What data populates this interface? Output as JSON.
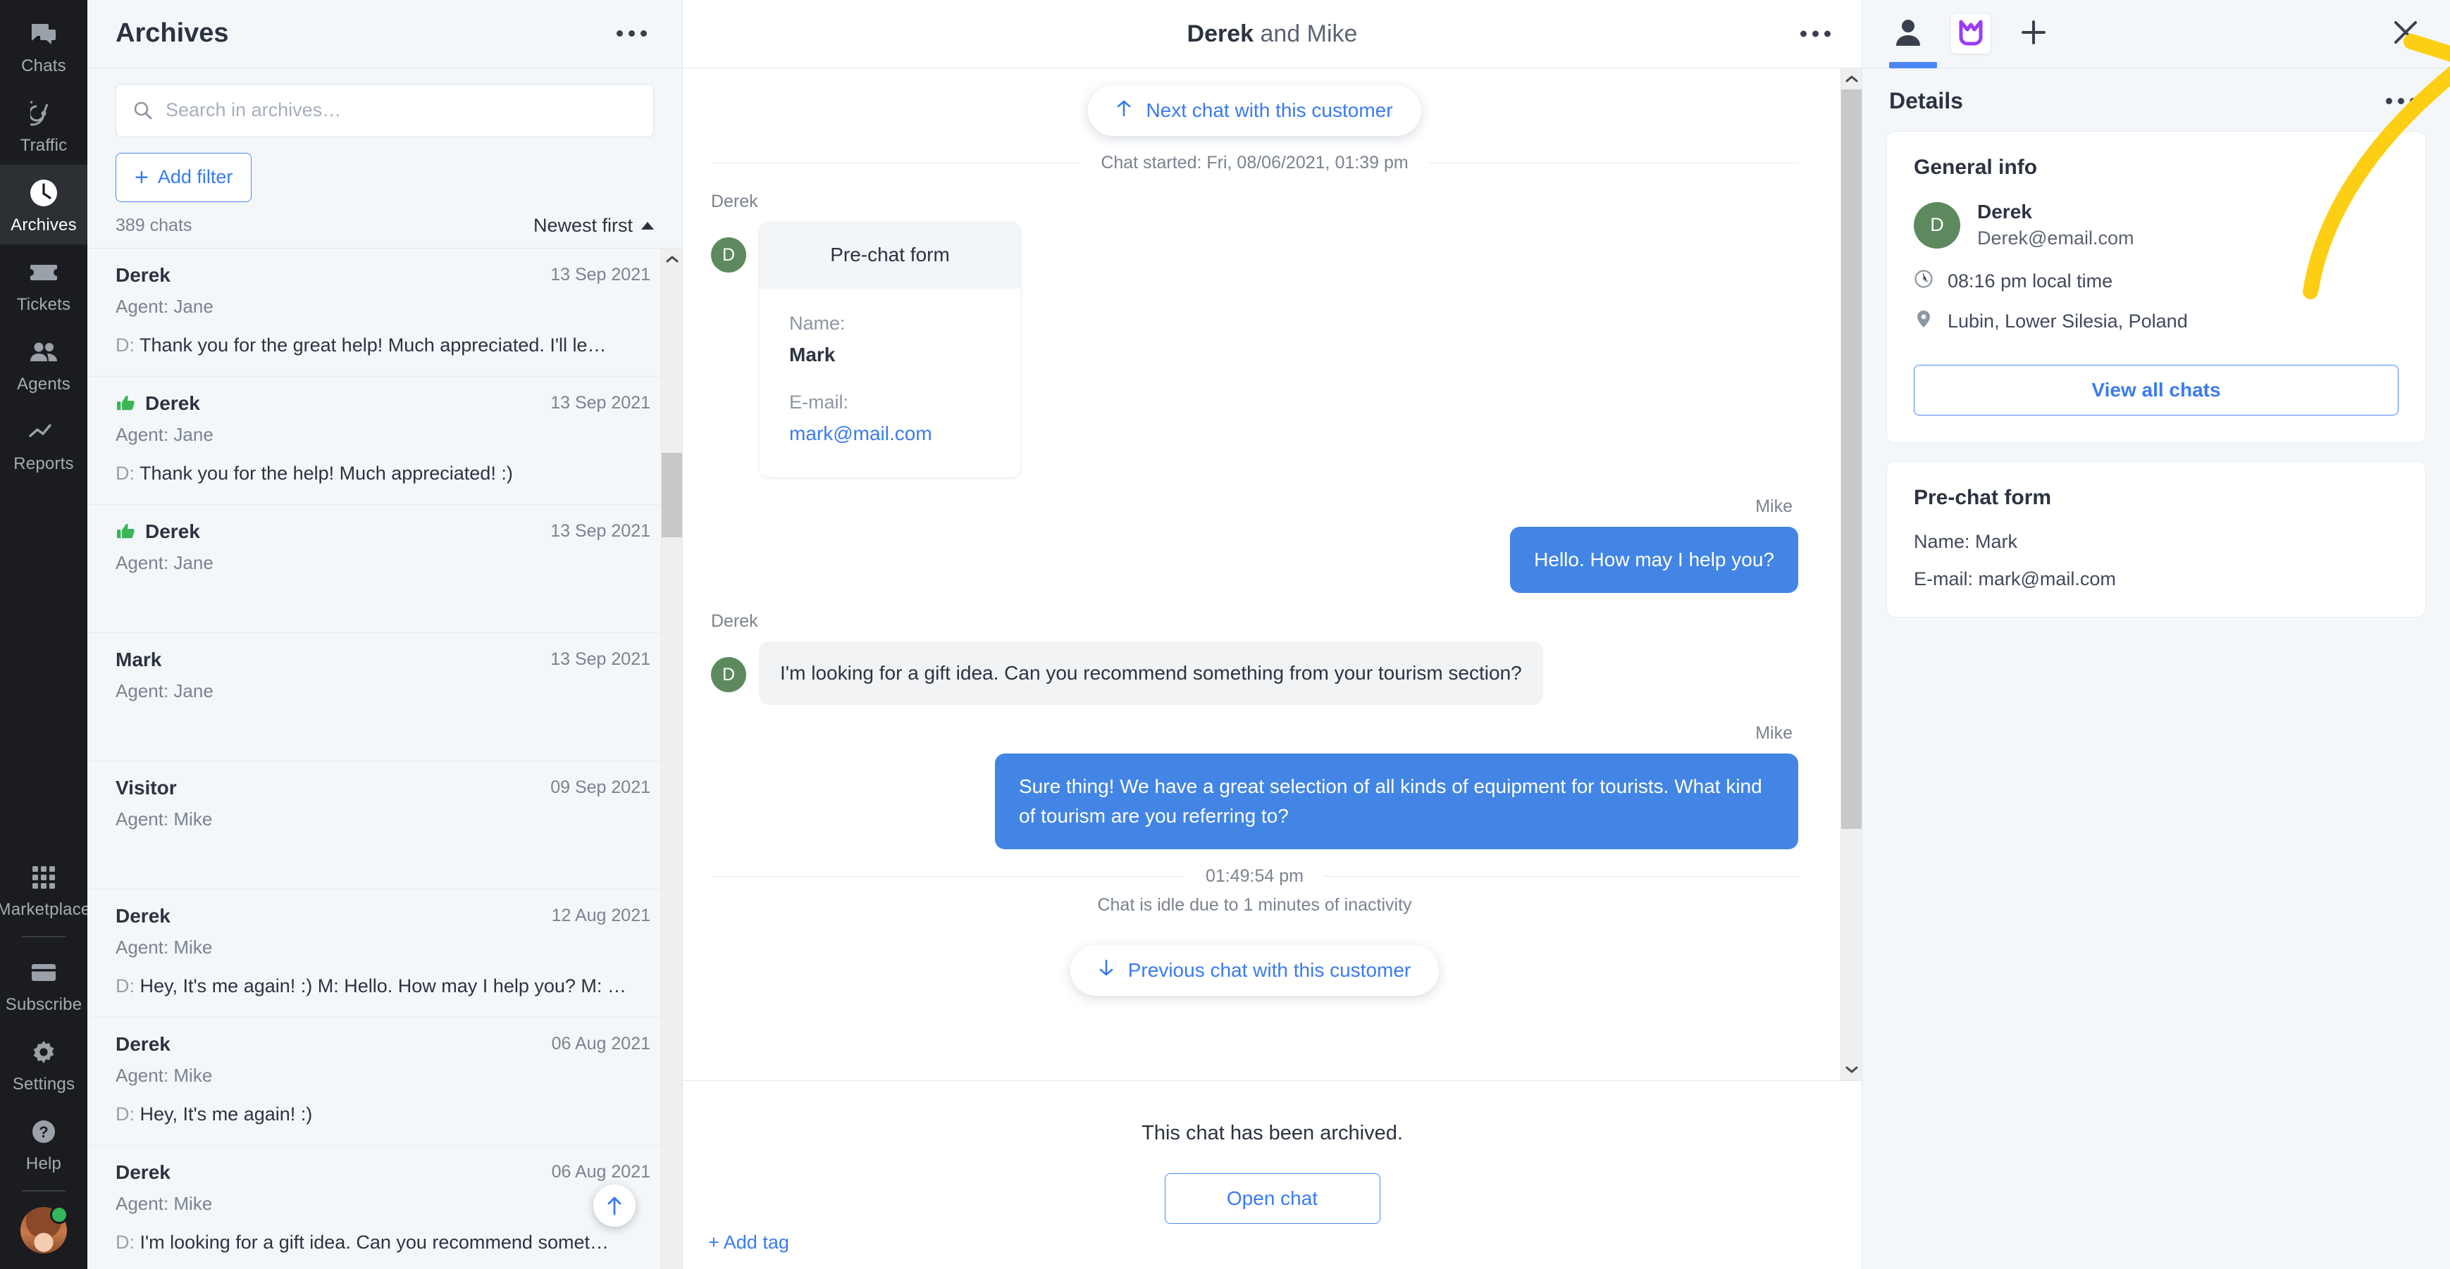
{
  "rail": {
    "items": [
      {
        "label": "Chats",
        "icon": "chats-icon",
        "active": false
      },
      {
        "label": "Traffic",
        "icon": "traffic-icon",
        "active": false
      },
      {
        "label": "Archives",
        "icon": "clock-icon",
        "active": true
      },
      {
        "label": "Tickets",
        "icon": "ticket-icon",
        "active": false
      },
      {
        "label": "Agents",
        "icon": "agents-icon",
        "active": false
      },
      {
        "label": "Reports",
        "icon": "reports-icon",
        "active": false
      }
    ],
    "bottom_items": [
      {
        "label": "Marketplace",
        "icon": "grid-icon"
      },
      {
        "label": "Subscribe",
        "icon": "card-icon"
      },
      {
        "label": "Settings",
        "icon": "gear-icon"
      },
      {
        "label": "Help",
        "icon": "help-icon"
      }
    ]
  },
  "archives": {
    "title": "Archives",
    "search_placeholder": "Search in archives…",
    "search_value": "",
    "add_filter_label": "Add filter",
    "count_label": "389 chats",
    "sort_label": "Newest first",
    "rows": [
      {
        "name": "Derek",
        "date": "13 Sep 2021",
        "agent": "Agent: Jane",
        "prefix": "D:",
        "snippet": "Thank you for the great help! Much appreciated. I'll le…",
        "rated": false
      },
      {
        "name": "Derek",
        "date": "13 Sep 2021",
        "agent": "Agent: Jane",
        "prefix": "D:",
        "snippet": "Thank you for the help! Much appreciated! :)",
        "rated": true
      },
      {
        "name": "Derek",
        "date": "13 Sep 2021",
        "agent": "Agent: Jane",
        "prefix": "",
        "snippet": "",
        "rated": true
      },
      {
        "name": "Mark",
        "date": "13 Sep 2021",
        "agent": "Agent: Jane",
        "prefix": "",
        "snippet": "",
        "rated": false
      },
      {
        "name": "Visitor",
        "date": "09 Sep 2021",
        "agent": "Agent: Mike",
        "prefix": "",
        "snippet": "",
        "rated": false
      },
      {
        "name": "Derek",
        "date": "12 Aug 2021",
        "agent": "Agent: Mike",
        "prefix": "D:",
        "snippet": "Hey, It's me again! :) M: Hello. How may I help you? M: …",
        "rated": false
      },
      {
        "name": "Derek",
        "date": "06 Aug 2021",
        "agent": "Agent: Mike",
        "prefix": "D:",
        "snippet": "Hey, It's me again! :)",
        "rated": false
      },
      {
        "name": "Derek",
        "date": "06 Aug 2021",
        "agent": "Agent: Mike",
        "prefix": "D:",
        "snippet": "I'm looking for a gift idea. Can you recommend somet…",
        "rated": false
      }
    ]
  },
  "chat": {
    "title_primary": "Derek",
    "title_rest": " and Mike",
    "next_chat_label": "Next chat with this customer",
    "started_label": "Chat started: Fri, 08/06/2021, 01:39 pm",
    "prechat": {
      "heading": "Pre-chat form",
      "name_label": "Name:",
      "name_value": "Mark",
      "email_label": "E-mail:",
      "email_value": "mark@mail.com"
    },
    "messages": [
      {
        "author": "Derek",
        "side": "in",
        "kind": "prechat",
        "avatar_letter": "D",
        "text": ""
      },
      {
        "author": "Mike",
        "side": "out",
        "kind": "text",
        "avatar_letter": "",
        "text": "Hello. How may I help you?"
      },
      {
        "author": "Derek",
        "side": "in",
        "kind": "text",
        "avatar_letter": "D",
        "text": "I'm looking for a gift idea. Can you recommend something from your tourism section?"
      },
      {
        "author": "Mike",
        "side": "out",
        "kind": "text",
        "avatar_letter": "",
        "text": "Sure thing! We have a great selection of all kinds of equipment for tourists. What kind of tourism are you referring to?"
      }
    ],
    "idle_time": "01:49:54 pm",
    "idle_note": "Chat is idle due to 1 minutes of inactivity",
    "previous_chat_label": "Previous chat with this customer",
    "archived_text": "This chat has been archived.",
    "open_chat_label": "Open chat",
    "add_tag_label": "+ Add tag"
  },
  "details": {
    "title": "Details",
    "general": {
      "card_title": "General info",
      "avatar_letter": "D",
      "name": "Derek",
      "email": "Derek@email.com",
      "local_time": "08:16 pm local time",
      "location": "Lubin, Lower Silesia, Poland",
      "view_all_label": "View all chats"
    },
    "prechat": {
      "card_title": "Pre-chat form",
      "name_line": "Name: Mark",
      "email_line": "E-mail: mark@mail.com"
    }
  },
  "colors": {
    "accent_blue": "#4285e4",
    "link_blue": "#3a7bf0",
    "annotation_yellow": "#fdcf14",
    "avatar_green": "#5c8a5e",
    "status_green": "#32b75d",
    "rail_dark": "#1a1c1f",
    "panel_bg": "#f4f7f9"
  }
}
